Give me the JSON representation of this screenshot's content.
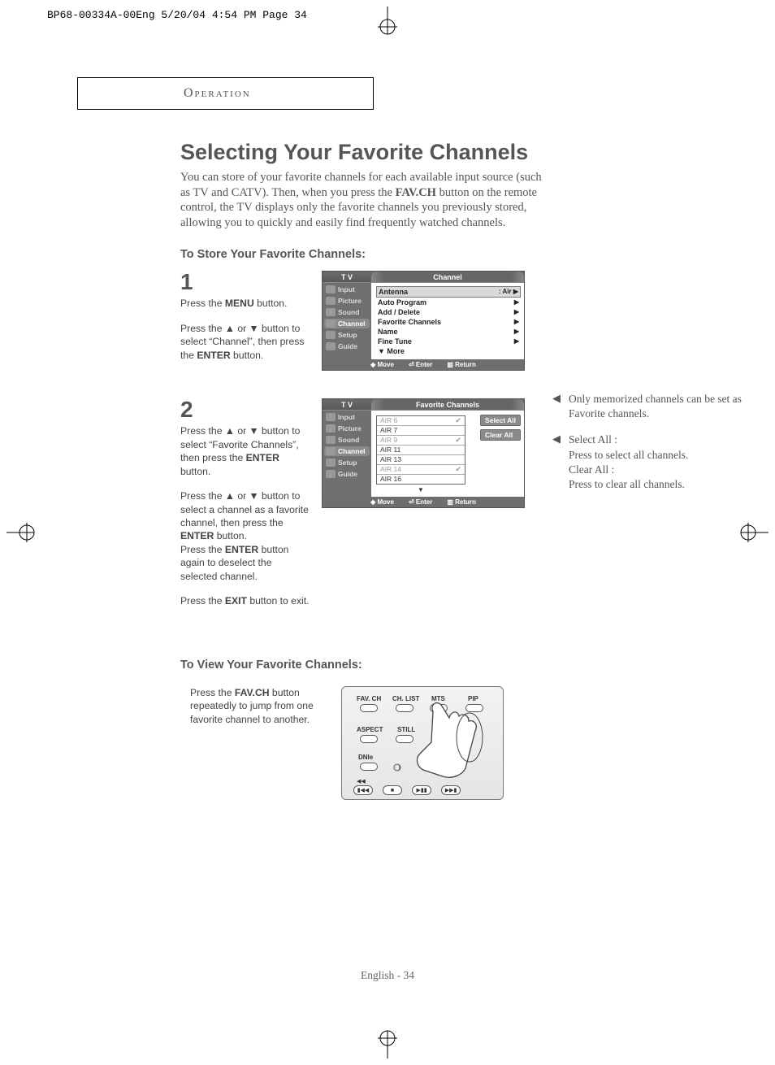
{
  "print_header": "BP68-00334A-00Eng  5/20/04  4:54 PM  Page 34",
  "section_label": "Operation",
  "title": "Selecting Your Favorite Channels",
  "intro_pre": "You can store of your favorite channels for each available input source (such as TV and CATV). Then, when you press the ",
  "intro_bold": "FAV.CH",
  "intro_post": " button on the remote control, the TV displays only the favorite channels you previously stored, allowing you to quickly and easily find frequently watched channels.",
  "sub_store": "To Store Your Favorite Channels:",
  "sub_view": "To View Your Favorite Channels:",
  "step1": {
    "num": "1",
    "p1a": "Press the ",
    "p1b": "MENU",
    "p1c": " button.",
    "p2": "Press the  ▲ or ▼ button to select “Channel”, then press the ",
    "p2b": "ENTER",
    "p2c": " button."
  },
  "step2": {
    "num": "2",
    "p1": "Press the ▲ or ▼ button to select “Favorite Channels”, then press the ",
    "p1b": "ENTER",
    "p1c": " button.",
    "p2": "Press the ▲ or ▼ button to select  a channel as a favorite channel, then press the ",
    "p2b": "ENTER",
    "p2c": " button.",
    "p3a": "Press the ",
    "p3b": "ENTER",
    "p3c": " button again to deselect the selected channel.",
    "p4a": "Press the ",
    "p4b": "EXIT",
    "p4c": " button to exit."
  },
  "view": {
    "p1a": "Press the ",
    "p1b": "FAV.CH",
    "p1c": " button repeatedly to jump from one favorite channel to another."
  },
  "notes": {
    "n1": "Only memorized channels can be set as Favorite channels.",
    "n2a": "Select All :",
    "n2b": "Press to select all channels.",
    "n2c": "Clear All :",
    "n2d": " Press to clear all channels."
  },
  "osd1": {
    "tv": "T V",
    "title": "Channel",
    "side": [
      "Input",
      "Picture",
      "Sound",
      "Channel",
      "Setup",
      "Guide"
    ],
    "rows": [
      {
        "label": "Antenna",
        "val": ":   Air",
        "hl": true
      },
      {
        "label": "Auto Program",
        "val": ""
      },
      {
        "label": "Add / Delete",
        "val": ""
      },
      {
        "label": "Favorite Channels",
        "val": ""
      },
      {
        "label": "Name",
        "val": ""
      },
      {
        "label": "Fine Tune",
        "val": ""
      },
      {
        "label": "▼ More",
        "val": "",
        "noarrow": true
      }
    ],
    "footer": {
      "move": "Move",
      "enter": "Enter",
      "return": "Return"
    }
  },
  "osd2": {
    "tv": "T V",
    "title": "Favorite Channels",
    "side": [
      "Input",
      "Picture",
      "Sound",
      "Channel",
      "Setup",
      "Guide"
    ],
    "channels": [
      {
        "name": "AIR 6",
        "dim": true,
        "chk": true
      },
      {
        "name": "AIR 7",
        "dim": false,
        "chk": false
      },
      {
        "name": "AIR 9",
        "dim": true,
        "chk": true
      },
      {
        "name": "AIR 11",
        "dim": false,
        "chk": false
      },
      {
        "name": "AIR 13",
        "dim": false,
        "chk": false
      },
      {
        "name": "AIR 14",
        "dim": true,
        "chk": true
      },
      {
        "name": "AIR 16",
        "dim": false,
        "chk": false
      }
    ],
    "select_all": "Select All",
    "clear_all": "Clear All",
    "more": "▼",
    "footer": {
      "move": "Move",
      "enter": "Enter",
      "return": "Return"
    }
  },
  "remote": {
    "labels": {
      "fav": "FAV. CH",
      "chlist": "CH. LIST",
      "mts": "MTS",
      "pip": "PIP",
      "aspect": "ASPECT",
      "still": "STILL",
      "dnie": "DNIe"
    }
  },
  "footer": "English - 34"
}
